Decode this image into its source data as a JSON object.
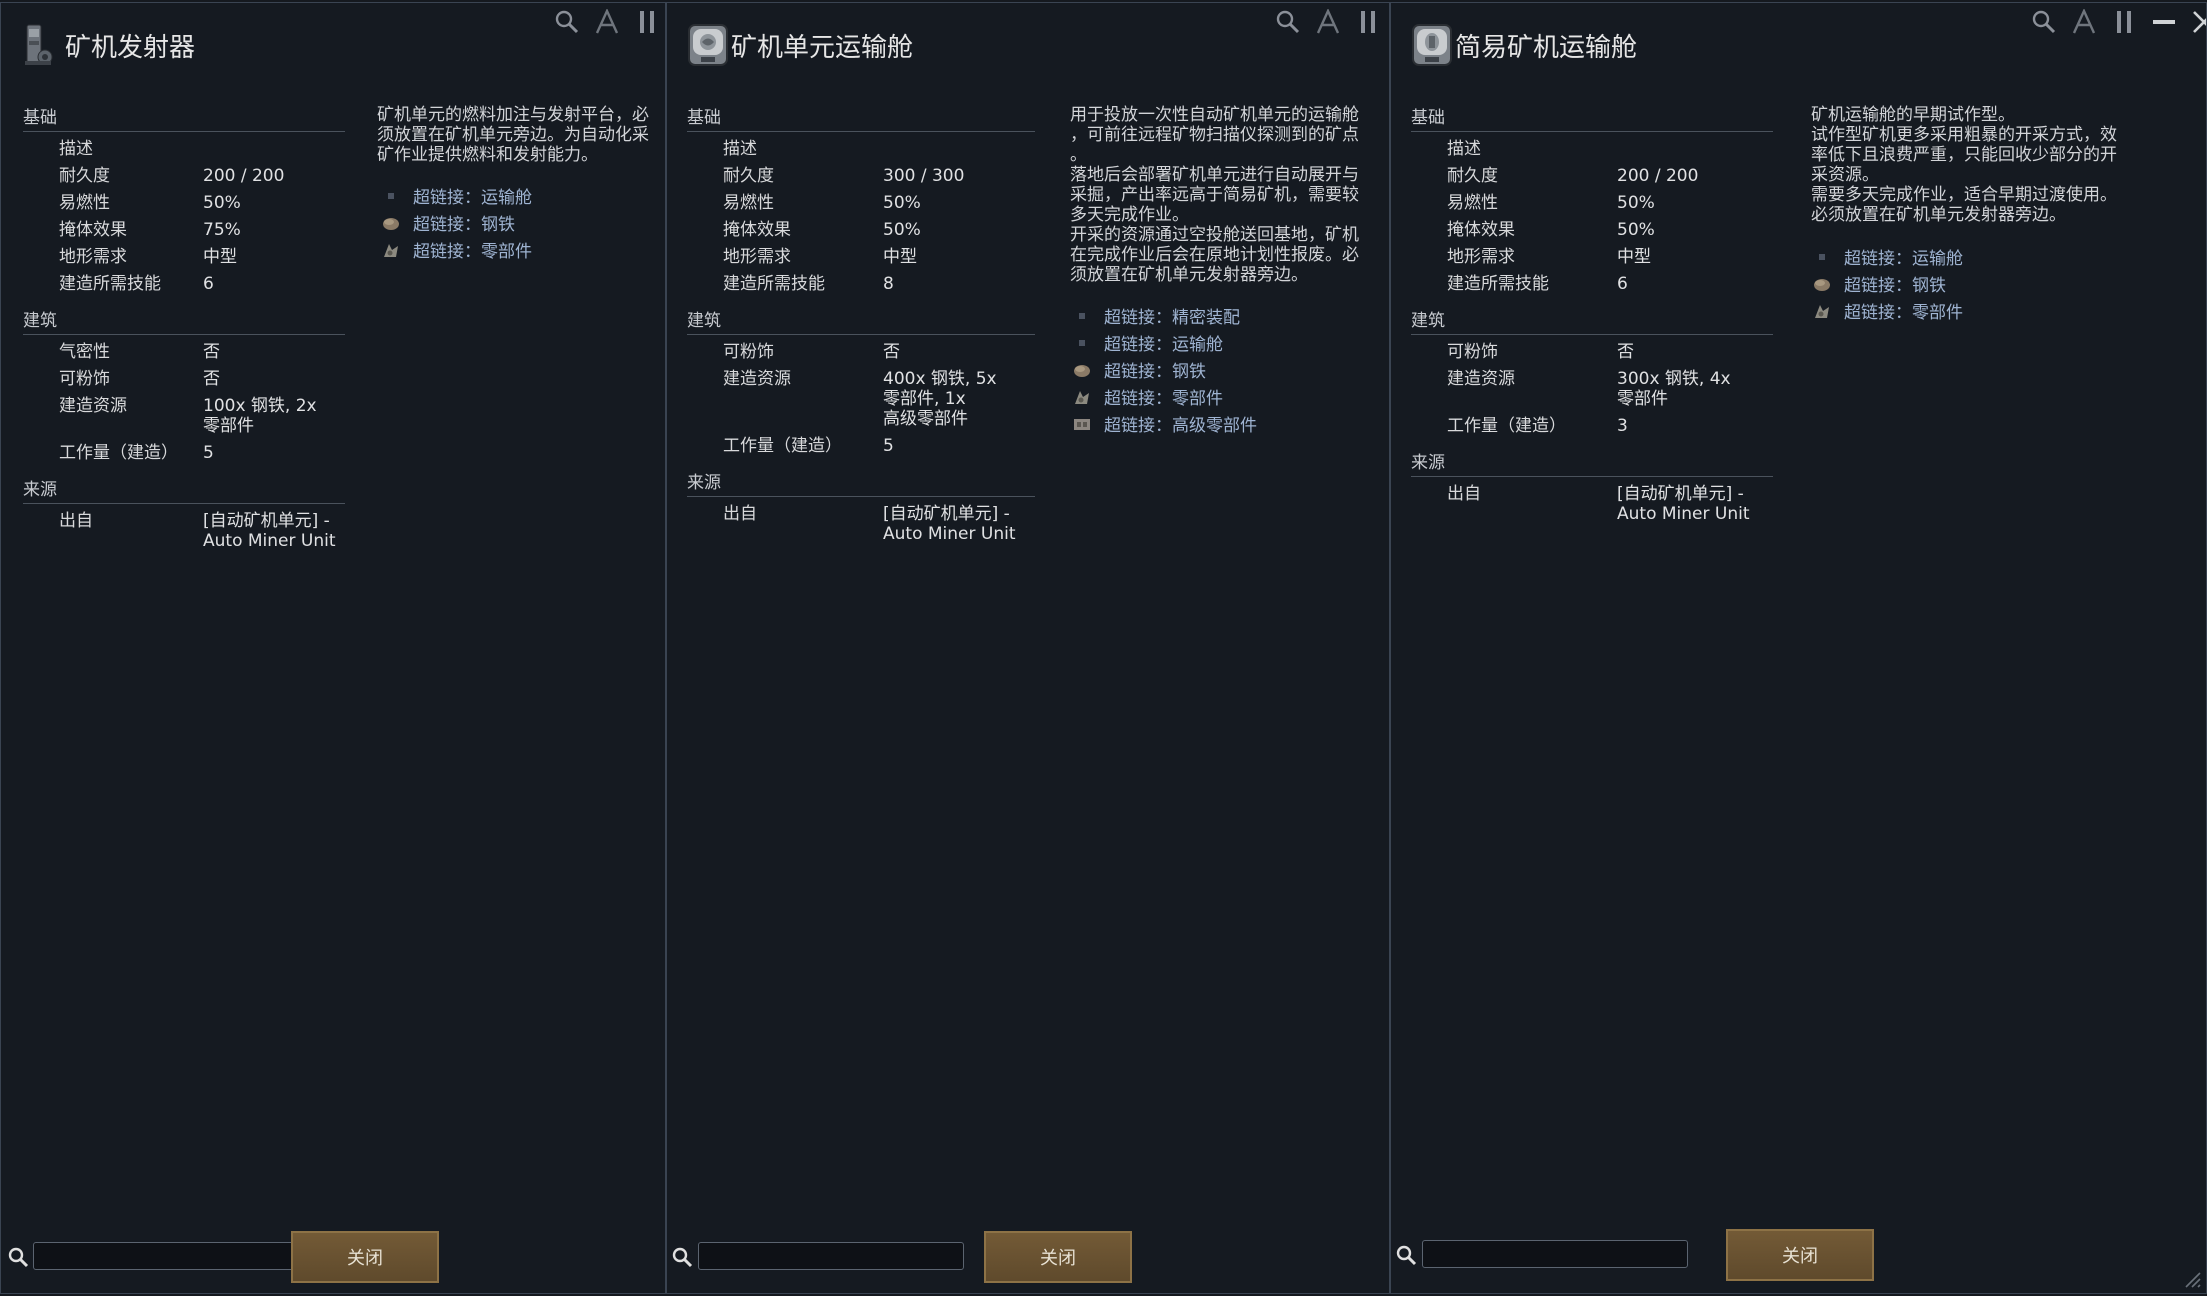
{
  "colors": {
    "panel_bg": "#151a21",
    "link": "#9fb4d2",
    "button": "#6b5433",
    "section_line": "#4a525c"
  },
  "panels": [
    {
      "title": "矿机发射器",
      "icon": "launcher-icon",
      "sections": [
        {
          "name": "基础",
          "rows": [
            {
              "label": "描述",
              "value": ""
            },
            {
              "label": "耐久度",
              "value": "200 / 200"
            },
            {
              "label": "易燃性",
              "value": "50%"
            },
            {
              "label": "掩体效果",
              "value": "75%"
            },
            {
              "label": "地形需求",
              "value": "中型"
            },
            {
              "label": "建造所需技能",
              "value": "6"
            }
          ]
        },
        {
          "name": "建筑",
          "rows": [
            {
              "label": "气密性",
              "value": "否"
            },
            {
              "label": "可粉饰",
              "value": "否"
            },
            {
              "label": "建造资源",
              "value": "100x 钢铁, 2x\n零部件"
            },
            {
              "label": "工作量（建造）",
              "value": "5"
            }
          ]
        },
        {
          "name": "来源",
          "rows": [
            {
              "label": "出自",
              "value": "[自动矿机单元] -\nAuto Miner Unit"
            }
          ]
        }
      ],
      "description": "矿机单元的燃料加注与发射平台，必\n须放置在矿机单元旁边。为自动化采\n矿作业提供燃料和发射能力。",
      "links": [
        {
          "icon": "bullet",
          "text": "超链接：运输舱"
        },
        {
          "icon": "steel-icon",
          "text": "超链接：钢铁"
        },
        {
          "icon": "component-icon",
          "text": "超链接：零部件"
        }
      ],
      "close_label": "关闭"
    },
    {
      "title": "矿机单元运输舱",
      "icon": "miner-pod-icon",
      "sections": [
        {
          "name": "基础",
          "rows": [
            {
              "label": "描述",
              "value": ""
            },
            {
              "label": "耐久度",
              "value": "300 / 300"
            },
            {
              "label": "易燃性",
              "value": "50%"
            },
            {
              "label": "掩体效果",
              "value": "50%"
            },
            {
              "label": "地形需求",
              "value": "中型"
            },
            {
              "label": "建造所需技能",
              "value": "8"
            }
          ]
        },
        {
          "name": "建筑",
          "rows": [
            {
              "label": "可粉饰",
              "value": "否"
            },
            {
              "label": "建造资源",
              "value": "400x 钢铁, 5x\n零部件, 1x\n高级零部件"
            },
            {
              "label": "工作量（建造）",
              "value": "5"
            }
          ]
        },
        {
          "name": "来源",
          "rows": [
            {
              "label": "出自",
              "value": "[自动矿机单元] -\nAuto Miner Unit"
            }
          ]
        }
      ],
      "description": "用于投放一次性自动矿机单元的运输舱\n，可前往远程矿物扫描仪探测到的矿点\n。\n落地后会部署矿机单元进行自动展开与\n采掘，产出率远高于简易矿机，需要较\n多天完成作业。\n开采的资源通过空投舱送回基地，矿机\n在完成作业后会在原地计划性报废。必\n须放置在矿机单元发射器旁边。",
      "links": [
        {
          "icon": "bullet",
          "text": "超链接：精密装配"
        },
        {
          "icon": "bullet",
          "text": "超链接：运输舱"
        },
        {
          "icon": "steel-icon",
          "text": "超链接：钢铁"
        },
        {
          "icon": "component-icon",
          "text": "超链接：零部件"
        },
        {
          "icon": "advanced-component-icon",
          "text": "超链接：高级零部件"
        }
      ],
      "close_label": "关闭"
    },
    {
      "title": "简易矿机运输舱",
      "icon": "simple-pod-icon",
      "sections": [
        {
          "name": "基础",
          "rows": [
            {
              "label": "描述",
              "value": ""
            },
            {
              "label": "耐久度",
              "value": "200 / 200"
            },
            {
              "label": "易燃性",
              "value": "50%"
            },
            {
              "label": "掩体效果",
              "value": "50%"
            },
            {
              "label": "地形需求",
              "value": "中型"
            },
            {
              "label": "建造所需技能",
              "value": "6"
            }
          ]
        },
        {
          "name": "建筑",
          "rows": [
            {
              "label": "可粉饰",
              "value": "否"
            },
            {
              "label": "建造资源",
              "value": "300x 钢铁, 4x\n零部件"
            },
            {
              "label": "工作量（建造）",
              "value": "3"
            }
          ]
        },
        {
          "name": "来源",
          "rows": [
            {
              "label": "出自",
              "value": "[自动矿机单元] -\nAuto Miner Unit"
            }
          ]
        }
      ],
      "description": "矿机运输舱的早期试作型。\n试作型矿机更多采用粗暴的开采方式，效\n率低下且浪费严重，只能回收少部分的开\n采资源。\n需要多天完成作业，适合早期过渡使用。\n必须放置在矿机单元发射器旁边。",
      "links": [
        {
          "icon": "bullet",
          "text": "超链接：运输舱"
        },
        {
          "icon": "steel-icon",
          "text": "超链接：钢铁"
        },
        {
          "icon": "component-icon",
          "text": "超链接：零部件"
        }
      ],
      "close_label": "关闭"
    }
  ]
}
